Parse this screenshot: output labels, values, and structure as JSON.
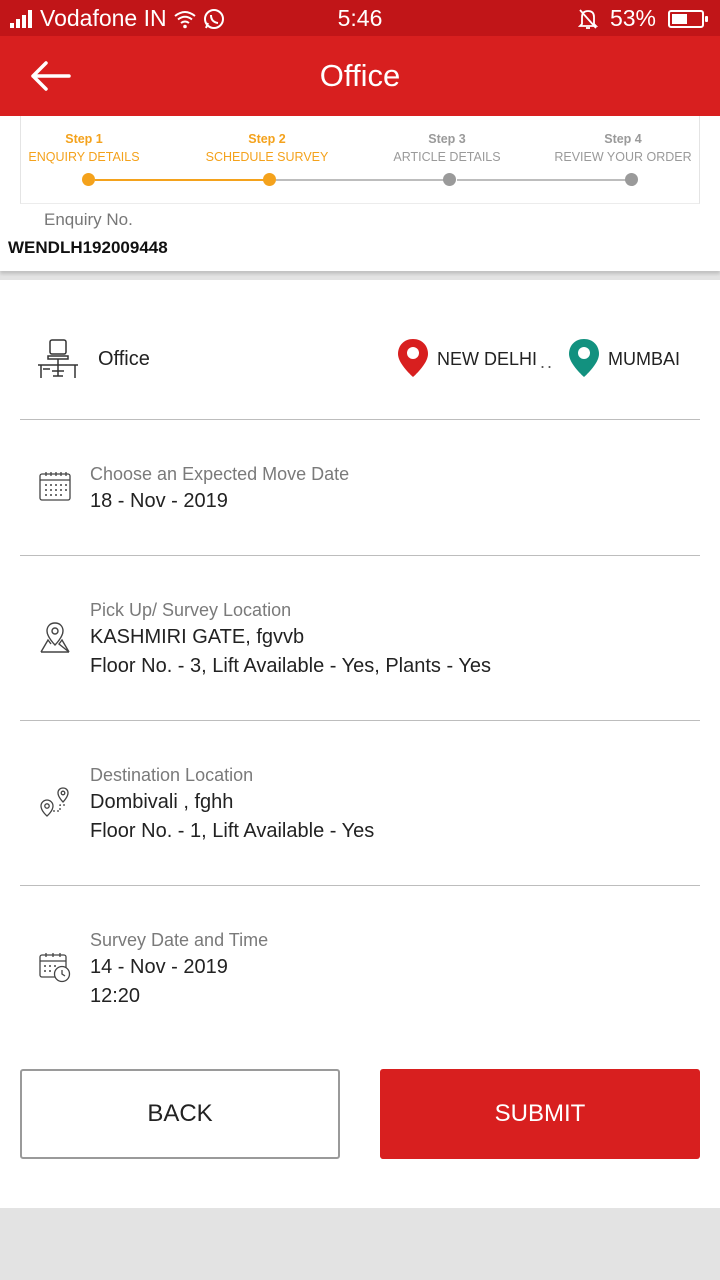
{
  "status_bar": {
    "carrier": "Vodafone IN",
    "time": "5:46",
    "battery": "53%",
    "battery_level": 0.53
  },
  "app_bar": {
    "title": "Office"
  },
  "stepper": {
    "steps": [
      {
        "num": "Step 1",
        "label": "ENQUIRY DETAILS",
        "state": "done"
      },
      {
        "num": "Step 2",
        "label": "SCHEDULE SURVEY",
        "state": "current"
      },
      {
        "num": "Step 3",
        "label": "ARTICLE DETAILS",
        "state": "pending"
      },
      {
        "num": "Step 4",
        "label": "REVIEW YOUR ORDER",
        "state": "pending"
      }
    ]
  },
  "enquiry": {
    "label": "Enquiry No.",
    "number": "WENDLH192009448"
  },
  "summary": {
    "category": "Office",
    "from_city": "NEW DELHI",
    "separator": "..",
    "to_city": "MUMBAI",
    "move_date": {
      "label": "Choose an Expected Move Date",
      "value": "18 - Nov - 2019"
    },
    "pickup": {
      "label": "Pick Up/ Survey Location",
      "address": "KASHMIRI GATE, fgvvb",
      "details": "Floor No. - 3, Lift Available - Yes, Plants - Yes"
    },
    "destination": {
      "label": "Destination Location",
      "address": "Dombivali , fghh",
      "details": "Floor No. - 1, Lift Available - Yes"
    },
    "survey": {
      "label": "Survey Date and Time",
      "date": "14 - Nov - 2019",
      "time": "12:20"
    }
  },
  "buttons": {
    "back": "BACK",
    "submit": "SUBMIT"
  },
  "colors": {
    "primary_red": "#d81f1f",
    "status_red": "#c11518",
    "step_active": "#f4a21c",
    "step_inactive": "#9a9a9a",
    "pin_from": "#d81f1f",
    "pin_to": "#12917f"
  },
  "icons": [
    "signal-icon",
    "wifi-icon",
    "whatsapp-icon",
    "mute-bell-icon",
    "battery-icon",
    "back-arrow-icon",
    "office-desk-icon",
    "location-pin-icon",
    "calendar-icon",
    "map-pin-icon",
    "route-pin-icon",
    "calendar-clock-icon"
  ]
}
